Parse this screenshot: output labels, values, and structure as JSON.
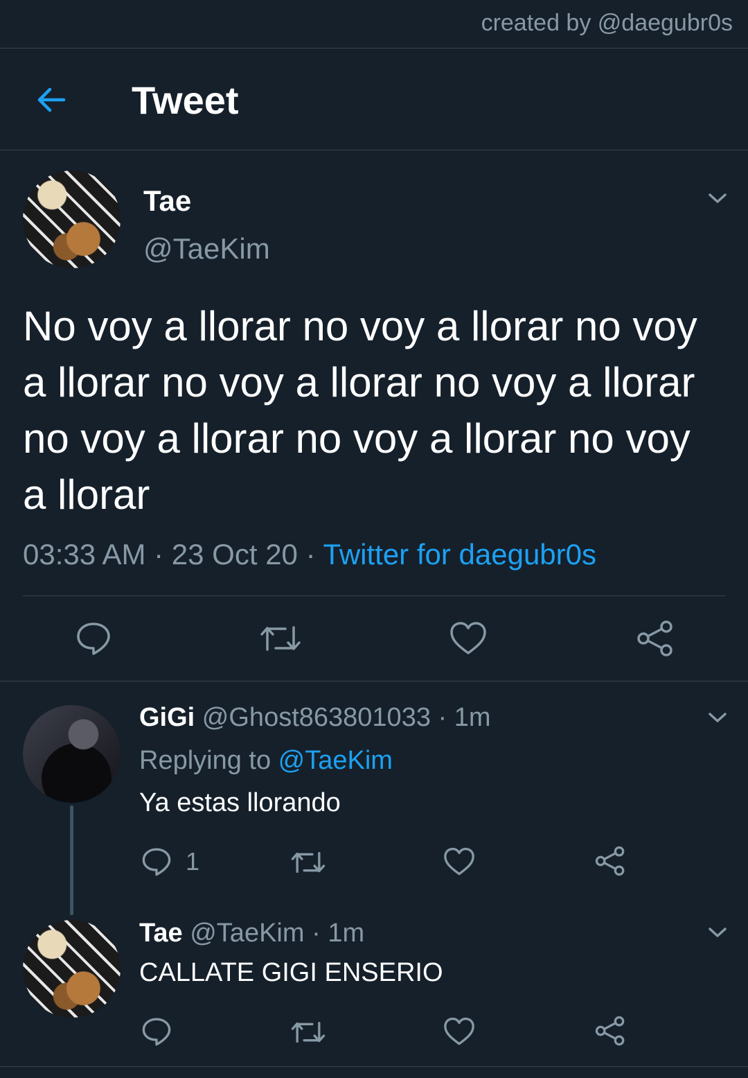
{
  "credit": "created by @daegubr0s",
  "header": {
    "title": "Tweet",
    "back_icon": "arrow-left-icon"
  },
  "main_tweet": {
    "name": "Tae",
    "handle": "@TaeKim",
    "text": "No voy a llorar no voy a llorar no voy a llorar no voy a llorar no voy a llorar no voy a llorar no voy a llorar no voy a llorar",
    "time": "03:33 AM",
    "sep1": " · ",
    "date": "23 Oct 20",
    "sep2": " · ",
    "source": "Twitter for daegubr0s",
    "actions": [
      "reply-icon",
      "retweet-icon",
      "like-icon",
      "share-icon"
    ]
  },
  "replies": [
    {
      "name": "GiGi",
      "handle": "@Ghost863801033",
      "sep": " · ",
      "time": "1m",
      "replying_label": "Replying to ",
      "replying_to": "@TaeKim",
      "text": "Ya estas llorando",
      "reply_count": "1"
    },
    {
      "name": "Tae",
      "handle": "@TaeKim",
      "sep": " · ",
      "time": "1m",
      "text": "CALLATE GIGI ENSERIO"
    }
  ],
  "colors": {
    "background": "#15202b",
    "accent": "#1da1f2",
    "muted": "#8899a6",
    "divider": "#38444d"
  }
}
